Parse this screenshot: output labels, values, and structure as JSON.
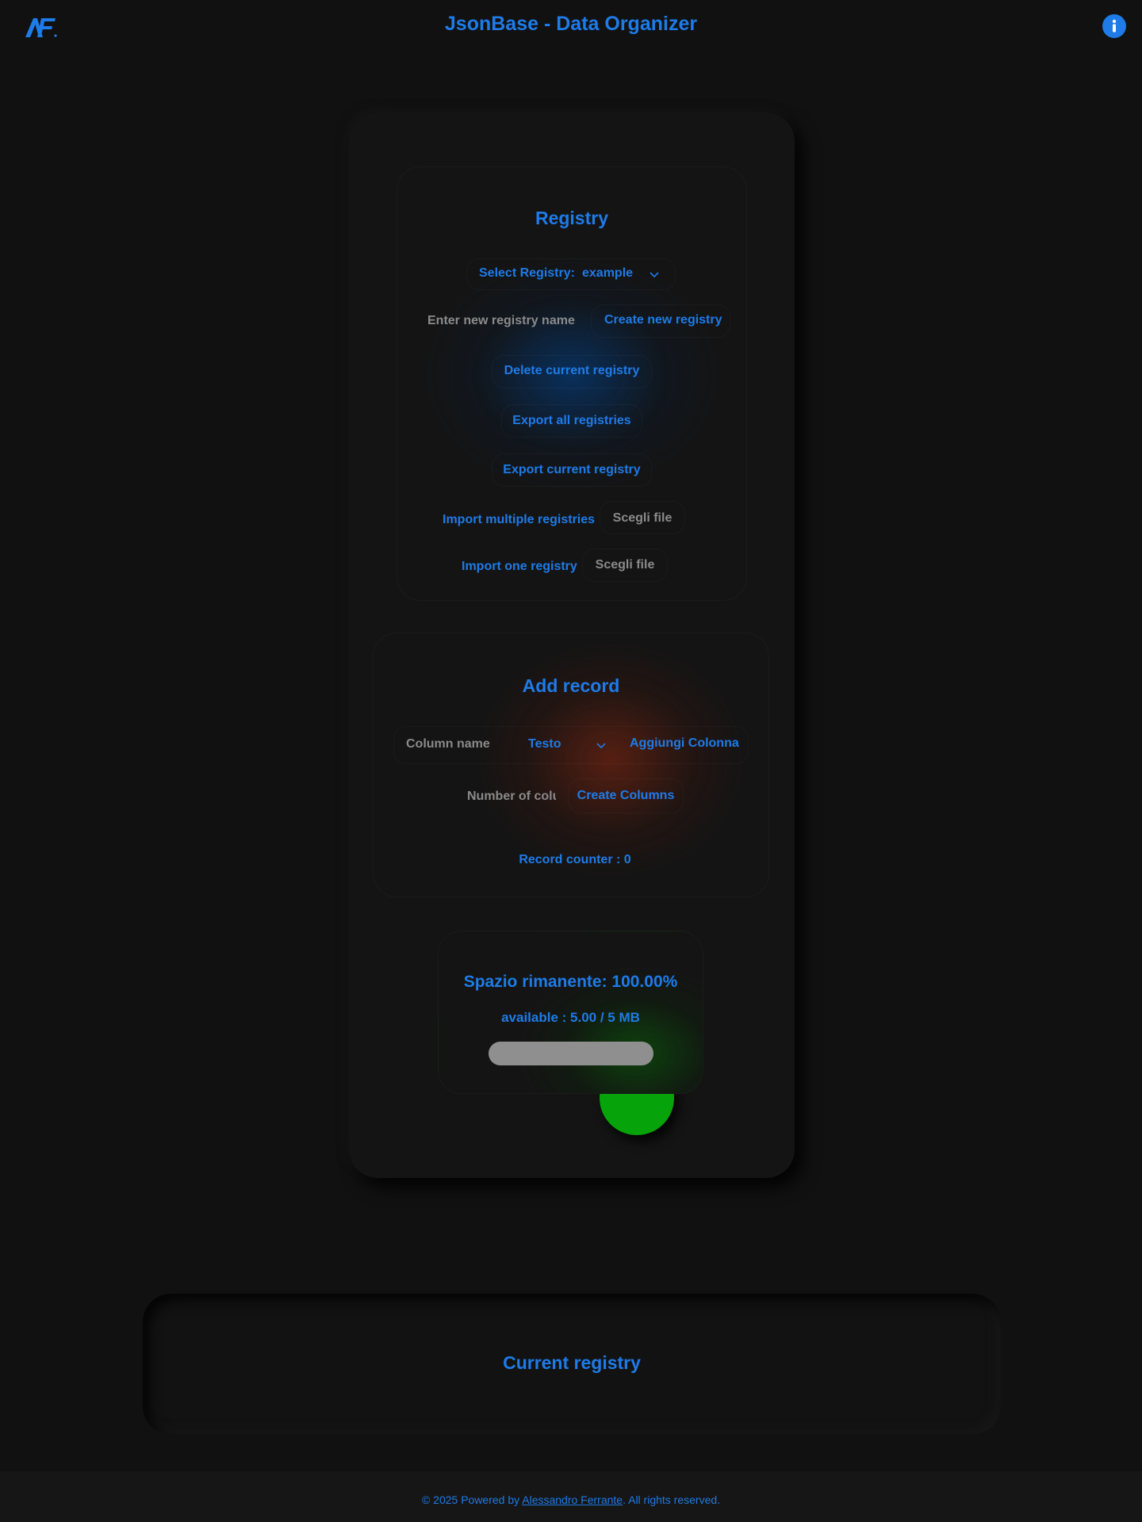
{
  "header": {
    "title": "JsonBase - Data Organizer",
    "logo_icon": "af-logo-icon",
    "info_icon": "info-icon"
  },
  "registry": {
    "title": "Registry",
    "select_label": "Select Registry:",
    "select_value": "example",
    "new_name_placeholder": "Enter new registry name",
    "create_label": "Create new registry",
    "delete_label": "Delete current registry",
    "export_all_label": "Export all registries",
    "export_current_label": "Export current registry",
    "import_multiple_label": "Import multiple registries",
    "import_multiple_file": "Scegli file",
    "import_one_label": "Import one registry",
    "import_one_file": "Scegli file"
  },
  "record": {
    "title": "Add record",
    "column_name_placeholder": "Column name",
    "column_type_value": "Testo",
    "add_column_label": "Aggiungi Colonna",
    "number_columns_placeholder": "Number of columns",
    "create_columns_label": "Create Columns",
    "record_counter": "Record counter : 0"
  },
  "space": {
    "remaining": "Spazio rimanente: 100.00%",
    "available": "available : 5.00 / 5 MB",
    "remaining_fraction": 1.0
  },
  "current_registry": {
    "title": "Current registry"
  },
  "footer": {
    "prefix": "© 2025 Powered by ",
    "author": "Alessandro Ferrante",
    "suffix": ". All rights reserved."
  },
  "colors": {
    "accent": "#1e7be8",
    "background": "#111111",
    "status_green": "#07a30a"
  }
}
